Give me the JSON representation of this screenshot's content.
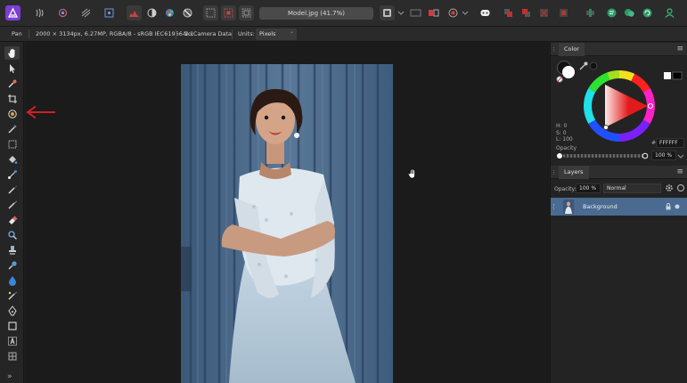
{
  "document": {
    "title": "Model.jpg (41.7%)"
  },
  "context_bar": {
    "tool_name": "Pan",
    "doc_info": "2000 × 3134px, 6.27MP, RGBA/8 - sRGB IEC61966-2.1",
    "camera": "No Camera Data",
    "units_label": "Units:",
    "units_value": "Pixels"
  },
  "color_panel": {
    "tab": "Color",
    "h": "H: 0",
    "s": "S: 0",
    "l": "L: 100",
    "hex_label": "#",
    "hex": "FFFFFF",
    "opacity_label": "Opacity",
    "opacity_value": "100 %"
  },
  "layers_panel": {
    "tab": "Layers",
    "opacity_label": "Opacity:",
    "opacity_value": "100 %",
    "blend_mode": "Normal",
    "layers": [
      {
        "name": "Background"
      }
    ]
  },
  "colors": {
    "accent": "#4a6a90",
    "annotation_arrow": "#d0202a"
  }
}
